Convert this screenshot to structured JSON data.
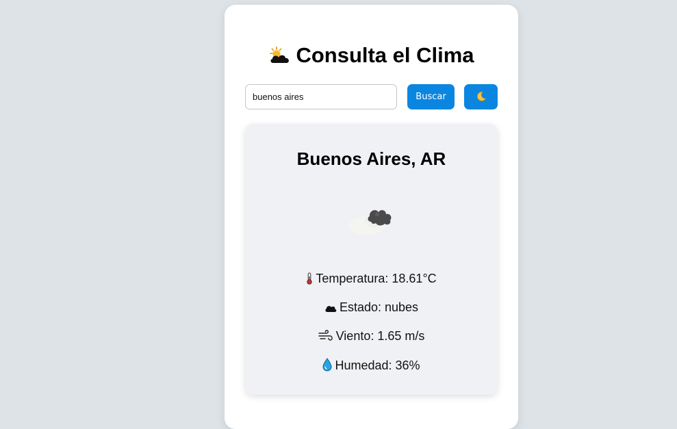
{
  "header": {
    "title": "Consulta el Clima",
    "title_icon": "sun-behind-cloud-icon"
  },
  "search": {
    "value": "buenos aires",
    "button_label": "Buscar",
    "theme_toggle_icon": "crescent-moon-icon"
  },
  "weather": {
    "city": "Buenos Aires, AR",
    "condition_icon": "dark-clouds-icon",
    "details": {
      "temperature": "Temperatura: 18.61°C",
      "state": "Estado: nubes",
      "wind": "Viento: 1.65 m/s",
      "humidity": "Humedad: 36%"
    }
  },
  "colors": {
    "accent": "#0b86e0",
    "page_background": "#dde3e7",
    "card_background": "#ffffff",
    "panel_background": "#f0f1f4"
  }
}
